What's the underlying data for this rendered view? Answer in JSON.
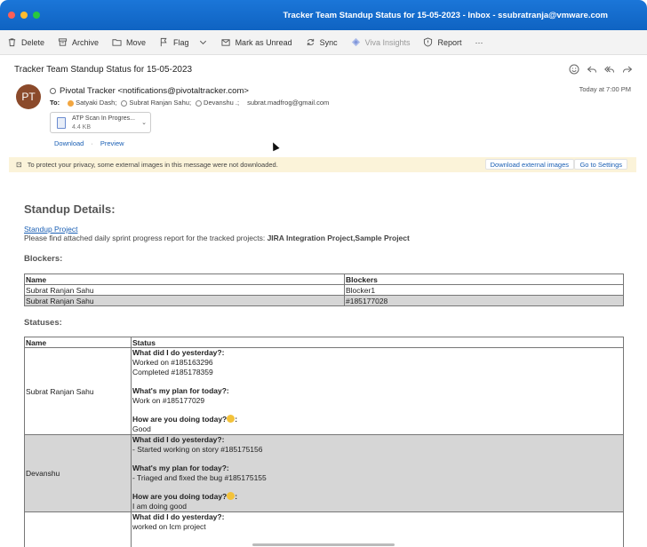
{
  "window": {
    "title": "Tracker Team Standup Status for 15-05-2023 - Inbox - ssubratranja@vmware.com"
  },
  "toolbar": {
    "delete": "Delete",
    "archive": "Archive",
    "move": "Move",
    "flag": "Flag",
    "mark_unread": "Mark as Unread",
    "sync": "Sync",
    "viva": "Viva Insights",
    "report": "Report",
    "more": "···"
  },
  "email": {
    "subject": "Tracker Team Standup Status for 15-05-2023",
    "avatar_initials": "PT",
    "sender": "Pivotal Tracker <notifications@pivotaltracker.com>",
    "date": "Today at 7:00 PM",
    "to_label": "To:",
    "recipients": [
      "Satyaki Dash;",
      "Subrat Ranjan Sahu;",
      "Devanshu .;",
      "subrat.madfrog@gmail.com"
    ],
    "attachment": {
      "name": "ATP Scan In Progres...",
      "size": "4.4 KB"
    },
    "download": "Download",
    "preview": "Preview",
    "link_sep": "·"
  },
  "banner": {
    "text": "To protect your privacy, some external images in this message were not downloaded.",
    "download_btn": "Download external images",
    "settings_btn": "Go to Settings"
  },
  "body": {
    "heading": "Standup Details:",
    "project_link": "Standup Project",
    "desc_prefix": "Please find attached daily sprint progress report for the tracked projects: ",
    "desc_projects": "JIRA Integration Project,Sample Project",
    "blockers_heading": "Blockers:",
    "blockers_table": {
      "headers": [
        "Name",
        "Blockers"
      ],
      "rows": [
        [
          "Subrat Ranjan Sahu",
          "Blocker1"
        ],
        [
          "Subrat Ranjan Sahu",
          "#185177028"
        ]
      ]
    },
    "statuses_heading": "Statuses:",
    "status_table": {
      "headers": [
        "Name",
        "Status"
      ],
      "q_yesterday": "What did I do yesterday?:",
      "q_plan": "What's my plan for today?:",
      "q_mood": "How are you doing today?",
      "q_mood_suffix": ":",
      "rows": [
        {
          "name": "Subrat Ranjan Sahu",
          "yesterday1": "Worked on #185163296",
          "yesterday2": "Completed #185178359",
          "plan": "Work on #185177029",
          "mood": "Good"
        },
        {
          "name": "Devanshu",
          "yesterday1": "- Started working on story #185175156",
          "plan": "- Triaged and fixed the bug #185175155",
          "mood": "I am doing good"
        },
        {
          "yesterday1": "worked on lcm project"
        }
      ]
    }
  }
}
